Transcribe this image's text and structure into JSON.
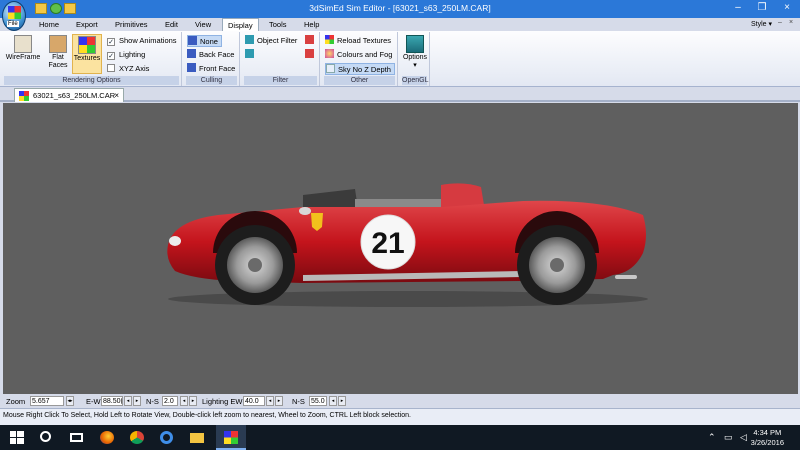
{
  "window": {
    "title": "3dSimEd Sim Editor - [63021_s63_250LM.CAR]",
    "app_button_label": "File"
  },
  "menu": {
    "items": [
      "Home",
      "Export",
      "Primitives",
      "Edit",
      "View",
      "Display",
      "Tools",
      "Help"
    ],
    "active": "Display",
    "style_label": "Style",
    "style_arrow": "▾",
    "minimize_glyph": "–",
    "close_glyph": "×"
  },
  "ribbon": {
    "rendering": {
      "label": "Rendering Options",
      "wireframe": "WireFrame",
      "flat_faces": "Flat Faces",
      "textures": "Textures",
      "show_animations": "Show Animations",
      "lighting": "Lighting",
      "xyz_axis": "XYZ Axis"
    },
    "culling": {
      "label": "Culling",
      "none": "None",
      "back_face": "Back Face",
      "front_face": "Front Face"
    },
    "filter": {
      "label": "Filter",
      "object_filter": "Object Filter"
    },
    "other": {
      "label": "Other",
      "reload_textures": "Reload Textures",
      "colours_fog": "Colours and Fog",
      "sky_no_z": "Sky No Z Depth"
    },
    "opengl": {
      "label": "OpenGL",
      "options": "Options",
      "options_arrow": "▾"
    },
    "check_mark": "✓"
  },
  "doc_tab": {
    "name": "63021_s63_250LM.CAR",
    "close": "×"
  },
  "scene": {
    "car_number": "21",
    "body_color": "#c4141c"
  },
  "controls": {
    "zoom_label": "Zoom",
    "zoom_value": "5.657",
    "ew_label": "E-W",
    "ew_value": "88.50(",
    "ns_label": "N-S",
    "ns_value": "2.0",
    "lighting_ew_label": "Lighting EW",
    "lighting_ew_value": "40.0",
    "lighting_ns_label": "N-S",
    "lighting_ns_value": "55.0",
    "spin_glyph": "◂▸",
    "left_glyph": "◂",
    "right_glyph": "▸"
  },
  "hint": "Mouse Right Click To Select, Hold Left to Rotate View, Double-click left  zoom to nearest, Wheel to Zoom, CTRL Left block selection.",
  "taskbar": {
    "time": "4:34 PM",
    "date": "3/26/2016"
  },
  "colors": {
    "titlebar": "#2b78d8",
    "viewport": "#5f5f5f",
    "taskbar": "#101923"
  }
}
